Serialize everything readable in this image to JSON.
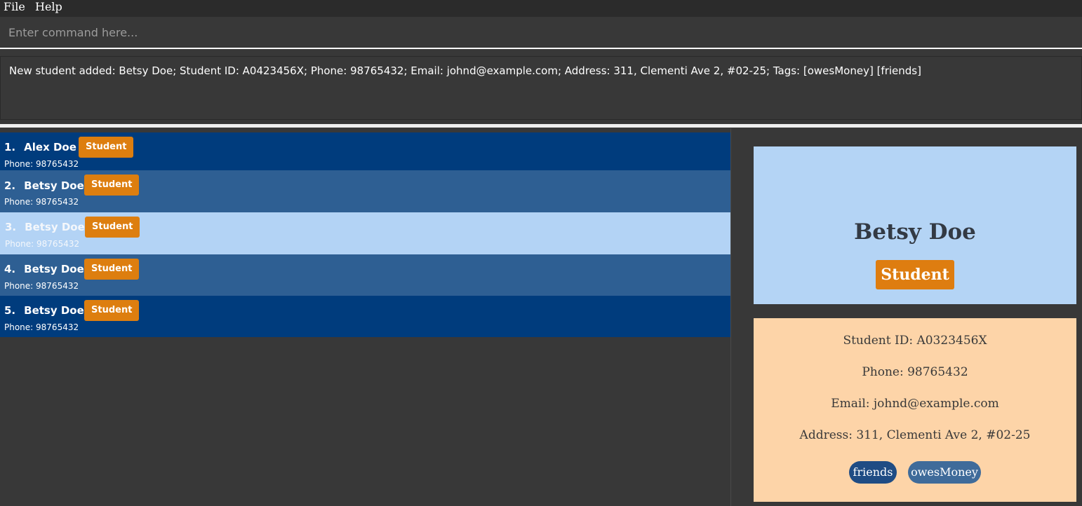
{
  "menu": {
    "file": "File",
    "help": "Help"
  },
  "command": {
    "placeholder": "Enter command here..."
  },
  "result": {
    "text": "New student added: Betsy Doe; Student ID: A0423456X; Phone: 98765432; Email: johnd@example.com; Address: 311, Clementi Ave 2, #02-25; Tags: [owesMoney] [friends]"
  },
  "list": [
    {
      "index": "1.",
      "name": "Alex Doe",
      "role": "Student",
      "phone": "Phone: 98765432"
    },
    {
      "index": "2.",
      "name": "Betsy Doe",
      "role": "Student",
      "phone": "Phone: 98765432"
    },
    {
      "index": "3.",
      "name": "Betsy Doe",
      "role": "Student",
      "phone": "Phone: 98765432"
    },
    {
      "index": "4.",
      "name": "Betsy Doe",
      "role": "Student",
      "phone": "Phone: 98765432"
    },
    {
      "index": "5.",
      "name": "Betsy Doe",
      "role": "Student",
      "phone": "Phone: 98765432"
    }
  ],
  "detail": {
    "name": "Betsy Doe",
    "role": "Student",
    "student_id": "Student ID: A0323456X",
    "phone": "Phone: 98765432",
    "email": "Email: johnd@example.com",
    "address": "Address: 311, Clementi Ave 2, #02-25",
    "tags": [
      "friends",
      "owesMoney"
    ]
  },
  "colors": {
    "background": "#383838",
    "card_dark": "#003c7d",
    "card_mid": "#2e5f93",
    "card_selected": "#b3d3f5",
    "badge": "#dd7e0f",
    "name_panel": "#b4d4f5",
    "info_panel": "#fdd4a8"
  }
}
